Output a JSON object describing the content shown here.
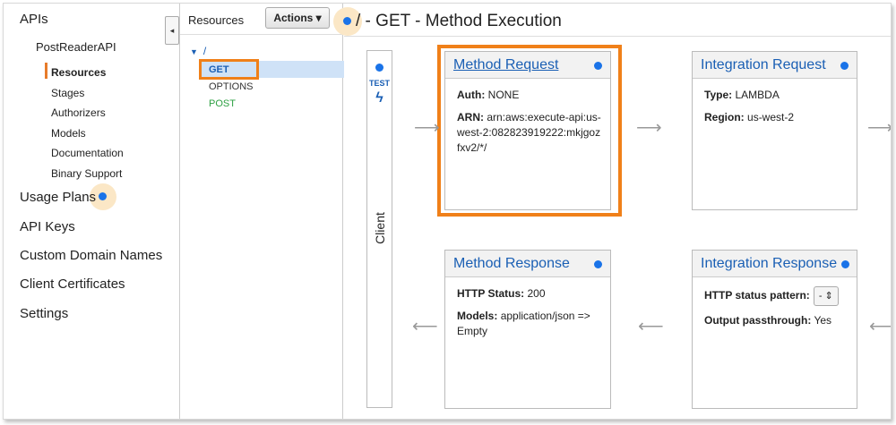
{
  "nav": {
    "apis_label": "APIs",
    "api_name": "PostReaderAPI",
    "sub_items": [
      "Resources",
      "Stages",
      "Authorizers",
      "Models",
      "Documentation",
      "Binary Support"
    ],
    "main_items": [
      "Usage Plans",
      "API Keys",
      "Custom Domain Names",
      "Client Certificates",
      "Settings"
    ]
  },
  "collapse_icon": "◂",
  "resources": {
    "title": "Resources",
    "actions_label": "Actions ▾",
    "root": "/",
    "methods": [
      "GET",
      "OPTIONS",
      "POST"
    ]
  },
  "main": {
    "title": "/ - GET - Method Execution",
    "client": {
      "test_label": "TEST",
      "bolt_icon": "ϟ",
      "label": "Client"
    },
    "method_request": {
      "title": "Method Request",
      "auth_label": "Auth:",
      "auth_value": "NONE",
      "arn_label": "ARN:",
      "arn_value": "arn:aws:execute-api:us-west-2:082823919222:mkjgozfxv2/*/"
    },
    "integration_request": {
      "title": "Integration Request",
      "type_label": "Type:",
      "type_value": "LAMBDA",
      "region_label": "Region:",
      "region_value": "us-west-2"
    },
    "method_response": {
      "title": "Method Response",
      "status_label": "HTTP Status:",
      "status_value": "200",
      "models_label": "Models:",
      "models_value": "application/json => Empty"
    },
    "integration_response": {
      "title": "Integration Response",
      "pattern_label": "HTTP status pattern:",
      "pattern_value": "-",
      "passthrough_label": "Output passthrough:",
      "passthrough_value": "Yes"
    }
  },
  "colors": {
    "accent_orange": "#f08019",
    "link_blue": "#1a5fb4",
    "dot_blue": "#1a73e8",
    "method_green": "#2ea043"
  }
}
